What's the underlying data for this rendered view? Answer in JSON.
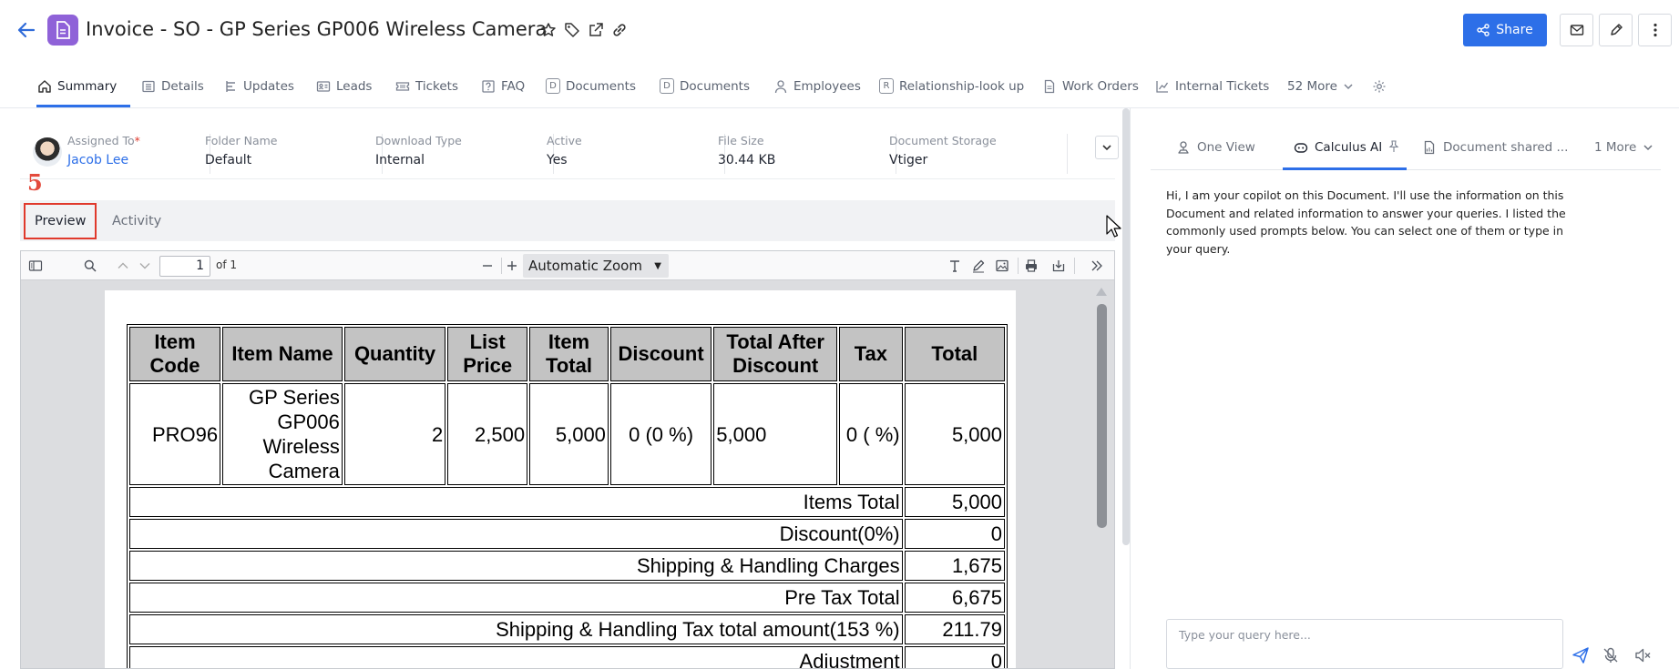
{
  "header": {
    "title": "Invoice - SO - GP Series GP006 Wireless Camera",
    "share_label": "Share"
  },
  "tabs": [
    {
      "label": "Summary"
    },
    {
      "label": "Details"
    },
    {
      "label": "Updates"
    },
    {
      "label": "Leads"
    },
    {
      "label": "Tickets"
    },
    {
      "label": "FAQ"
    },
    {
      "label": "Documents"
    },
    {
      "label": "Documents"
    },
    {
      "label": "Employees"
    },
    {
      "label": "Relationship-look up"
    },
    {
      "label": "Work Orders"
    },
    {
      "label": "Internal Tickets"
    },
    {
      "label": "52 More"
    }
  ],
  "tab_letters": {
    "documents_1": "D",
    "documents_2": "D",
    "relationship": "R"
  },
  "summary_fields": {
    "assigned_to": {
      "label": "Assigned To",
      "value": "Jacob Lee"
    },
    "folder_name": {
      "label": "Folder Name",
      "value": "Default"
    },
    "download_type": {
      "label": "Download Type",
      "value": "Internal"
    },
    "active": {
      "label": "Active",
      "value": "Yes"
    },
    "file_size": {
      "label": "File Size",
      "value": "30.44 KB"
    },
    "document_storage": {
      "label": "Document Storage",
      "value": "Vtiger"
    }
  },
  "annotation_number": "5",
  "subtabs": {
    "preview": "Preview",
    "activity": "Activity"
  },
  "pdf_viewer": {
    "page_number": "1",
    "of_pages": "of 1",
    "zoom": "Automatic Zoom"
  },
  "invoice_table": {
    "headers": [
      "Item Code",
      "Item Name",
      "Quantity",
      "List Price",
      "Item Total",
      "Discount",
      "Total After Discount",
      "Tax",
      "Total"
    ],
    "item": {
      "code": "PRO96",
      "name": "GP Series GP006 Wireless Camera",
      "quantity": "2",
      "list_price": "2,500",
      "item_total": "5,000",
      "discount": "0  (0 %)",
      "total_after_discount": "5,000",
      "tax": "0    ( %)",
      "total": "5,000"
    },
    "totals": [
      {
        "label": "Items Total",
        "value": "5,000"
      },
      {
        "label": "Discount(0%)",
        "value": "0"
      },
      {
        "label": "Shipping & Handling Charges",
        "value": "1,675"
      },
      {
        "label": "Pre Tax Total",
        "value": "6,675"
      },
      {
        "label": "Shipping & Handling Tax total amount(153 %)",
        "value": "211.79"
      },
      {
        "label": "Adjustment",
        "value": "0"
      }
    ]
  },
  "right_panel": {
    "tabs": [
      {
        "label": "One View"
      },
      {
        "label": "Calculus AI"
      },
      {
        "label": "Document shared ..."
      },
      {
        "label": "1 More"
      }
    ],
    "ai_message": "Hi, I am your copilot on this Document. I'll use the information on this Document and related information to answer your queries. I listed the commonly used prompts below. You can select one of them or type in your query.",
    "query_placeholder": "Type your query here..."
  },
  "colors": {
    "accent": "#2d6fe8",
    "doc_badge": "#8f62d8",
    "annotation": "#e0392c"
  }
}
